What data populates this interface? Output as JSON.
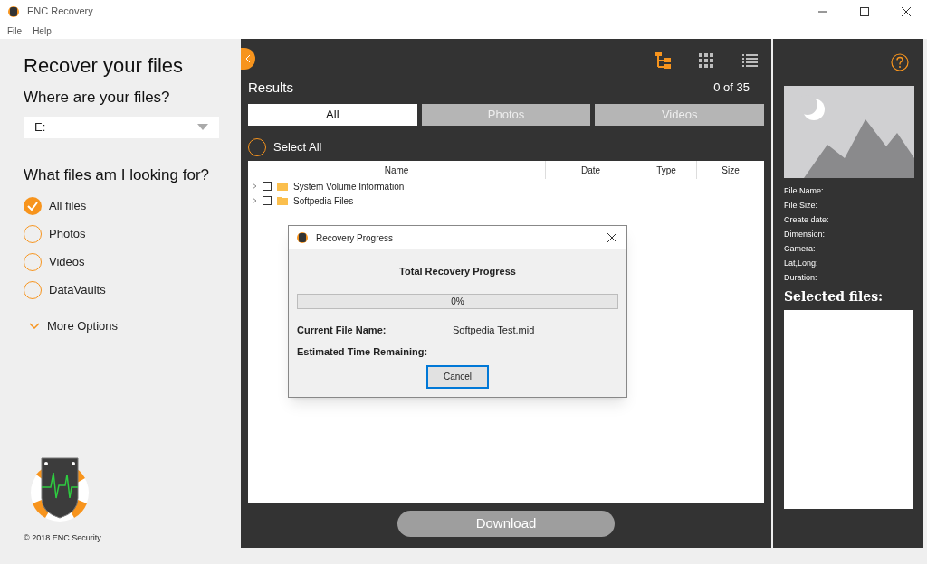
{
  "window": {
    "title": "ENC Recovery"
  },
  "menu": [
    "File",
    "Help"
  ],
  "sidebar": {
    "heading": "Recover your files",
    "location_label": "Where are your files?",
    "drive": "E:",
    "types_label": "What files am I looking for?",
    "file_types": [
      {
        "label": "All files",
        "selected": true
      },
      {
        "label": "Photos",
        "selected": false
      },
      {
        "label": "Videos",
        "selected": false
      },
      {
        "label": "DataVaults",
        "selected": false
      }
    ],
    "more_options": "More Options",
    "copyright": "© 2018 ENC Security"
  },
  "results": {
    "view_modes": [
      {
        "kind": "tree",
        "selected": true
      },
      {
        "kind": "grid",
        "selected": false
      },
      {
        "kind": "list",
        "selected": false
      }
    ],
    "title": "Results",
    "count": "0 of 35",
    "tabs": [
      {
        "label": "All",
        "selected": true
      },
      {
        "label": "Photos",
        "selected": false
      },
      {
        "label": "Videos",
        "selected": false
      }
    ],
    "select_all": {
      "label": "Select All",
      "checked": false
    },
    "columns": [
      "Name",
      "Date",
      "Type",
      "Size"
    ],
    "rows": [
      {
        "name": "System Volume Information",
        "checked": false
      },
      {
        "name": "Softpedia Files",
        "checked": false
      }
    ],
    "download": "Download"
  },
  "details": {
    "fields": [
      "File Name:",
      "File Size:",
      "Create date:",
      "Dimension:",
      "Camera:",
      "Lat,Long:",
      "Duration:"
    ],
    "selected_heading": "Selected files:"
  },
  "dialog": {
    "title": "Recovery Progress",
    "heading": "Total Recovery Progress",
    "progress": {
      "level": 0,
      "reading": "0%"
    },
    "current_label": "Current File Name:",
    "current_value": "Softpedia Test.mid",
    "eta_label": "Estimated Time Remaining:",
    "cancel": "Cancel"
  }
}
